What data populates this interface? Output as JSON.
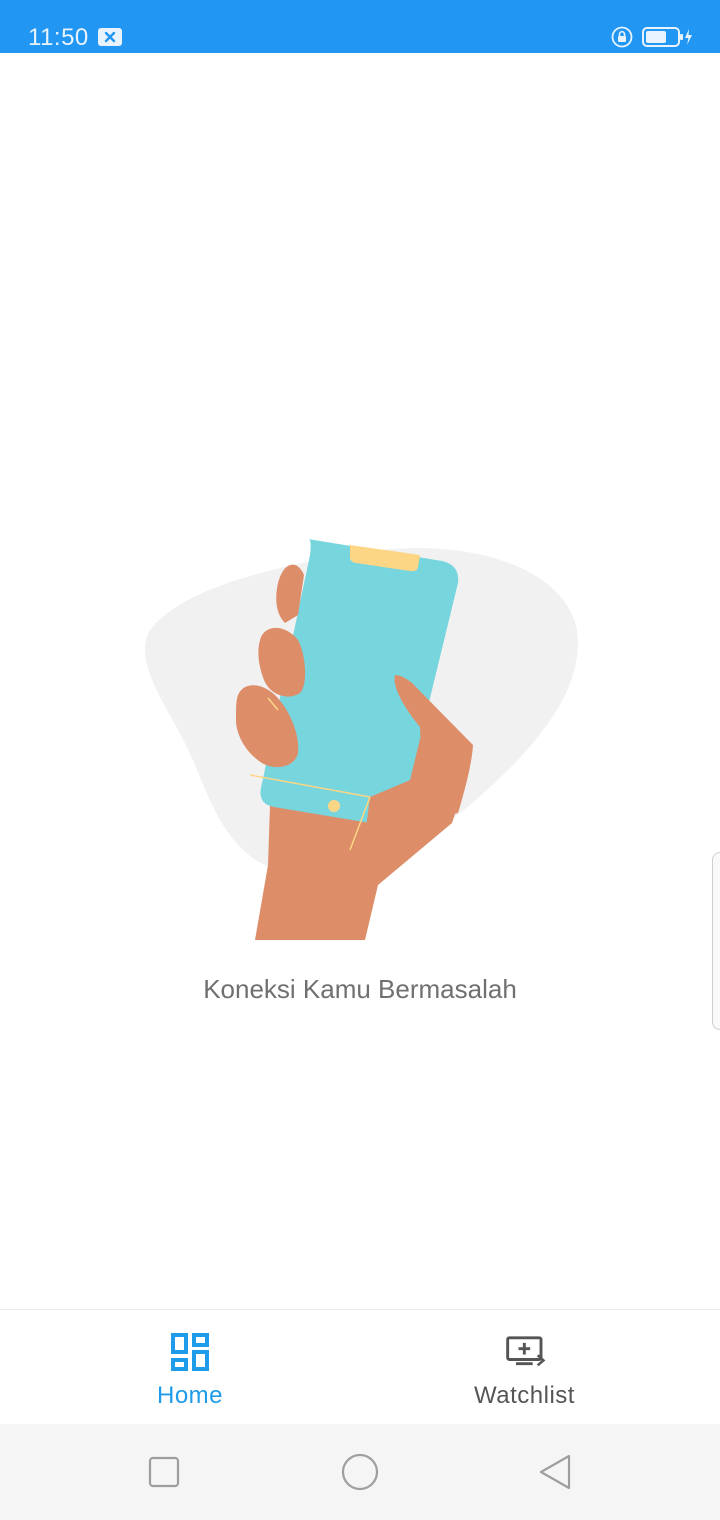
{
  "status_bar": {
    "time": "11:50",
    "background": "#2196f3",
    "icons": [
      "notification-x-icon",
      "rotation-lock-icon",
      "battery-charging-icon"
    ]
  },
  "main": {
    "error_message": "Koneksi Kamu Bermasalah",
    "illustration": "hand-holding-phone-illustration"
  },
  "bottom_nav": {
    "items": [
      {
        "label": "Home",
        "icon": "dashboard-grid-icon",
        "active": true,
        "color": "#1e9be9"
      },
      {
        "label": "Watchlist",
        "icon": "add-to-watchlist-icon",
        "active": false,
        "color": "#555555"
      }
    ]
  },
  "system_nav": {
    "buttons": [
      "recent-apps-icon",
      "home-circle-icon",
      "back-triangle-icon"
    ]
  }
}
